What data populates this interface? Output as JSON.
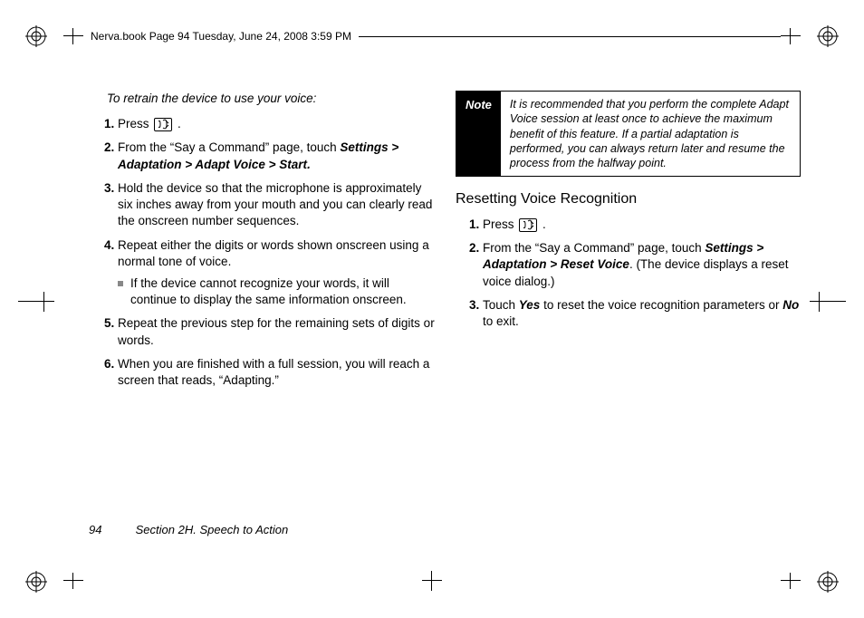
{
  "book_line": "Nerva.book  Page 94  Tuesday, June 24, 2008  3:59 PM",
  "left": {
    "intro": "To retrain the device to use your voice:",
    "step1_a": "Press ",
    "step1_b": ".",
    "step2_a": "From the “Say a Command” page, touch ",
    "step2_b1": "Settings",
    "step2_b2": " > ",
    "step2_b3": "Adaptation",
    "step2_b4": " > ",
    "step2_b5": "Adapt Voice",
    "step2_b6": " > ",
    "step2_b7": "Start",
    "step2_b8": ".",
    "step3": "Hold the device so that the microphone is approximately six inches away from your mouth and you can clearly read the onscreen number sequences.",
    "step4": "Repeat either the digits or words shown onscreen using a normal tone of voice.",
    "step4_sub": "If the device cannot recognize your words, it will continue to display the same information onscreen.",
    "step5": "Repeat the previous step for the remaining sets of digits or words.",
    "step6": "When you are finished with a full session, you will reach a screen that reads, “Adapting.”"
  },
  "right": {
    "note_label": "Note",
    "note_body": "It is recommended that you perform the complete Adapt Voice session at least once to achieve the maximum benefit of this feature. If a partial adaptation is performed, you can always return later and resume the process from the halfway point.",
    "heading": "Resetting Voice Recognition",
    "step1_a": "Press ",
    "step1_b": ".",
    "step2_a": "From the “Say a Command” page, touch ",
    "step2_b1": "Settings",
    "step2_b2": " > ",
    "step2_b3": "Adaptation",
    "step2_b4": " > ",
    "step2_b5": "Reset Voice",
    "step2_c": ". (The device displays a reset voice dialog.)",
    "step3_a": "Touch ",
    "step3_b1": "Yes",
    "step3_c": " to reset the voice recognition parameters or ",
    "step3_b2": "No",
    "step3_d": " to exit."
  },
  "footer": {
    "page": "94",
    "section": "Section 2H. Speech to Action"
  }
}
